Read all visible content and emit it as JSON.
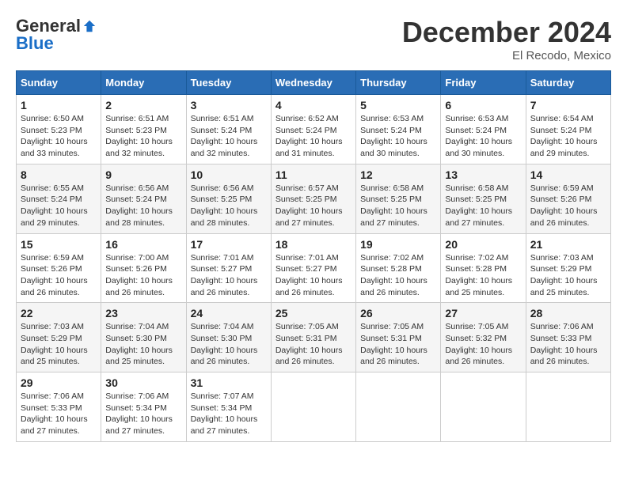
{
  "logo": {
    "general": "General",
    "blue": "Blue"
  },
  "title": "December 2024",
  "subtitle": "El Recodo, Mexico",
  "headers": [
    "Sunday",
    "Monday",
    "Tuesday",
    "Wednesday",
    "Thursday",
    "Friday",
    "Saturday"
  ],
  "weeks": [
    [
      {
        "day": "1",
        "sunrise": "Sunrise: 6:50 AM",
        "sunset": "Sunset: 5:23 PM",
        "daylight": "Daylight: 10 hours and 33 minutes."
      },
      {
        "day": "2",
        "sunrise": "Sunrise: 6:51 AM",
        "sunset": "Sunset: 5:23 PM",
        "daylight": "Daylight: 10 hours and 32 minutes."
      },
      {
        "day": "3",
        "sunrise": "Sunrise: 6:51 AM",
        "sunset": "Sunset: 5:24 PM",
        "daylight": "Daylight: 10 hours and 32 minutes."
      },
      {
        "day": "4",
        "sunrise": "Sunrise: 6:52 AM",
        "sunset": "Sunset: 5:24 PM",
        "daylight": "Daylight: 10 hours and 31 minutes."
      },
      {
        "day": "5",
        "sunrise": "Sunrise: 6:53 AM",
        "sunset": "Sunset: 5:24 PM",
        "daylight": "Daylight: 10 hours and 30 minutes."
      },
      {
        "day": "6",
        "sunrise": "Sunrise: 6:53 AM",
        "sunset": "Sunset: 5:24 PM",
        "daylight": "Daylight: 10 hours and 30 minutes."
      },
      {
        "day": "7",
        "sunrise": "Sunrise: 6:54 AM",
        "sunset": "Sunset: 5:24 PM",
        "daylight": "Daylight: 10 hours and 29 minutes."
      }
    ],
    [
      {
        "day": "8",
        "sunrise": "Sunrise: 6:55 AM",
        "sunset": "Sunset: 5:24 PM",
        "daylight": "Daylight: 10 hours and 29 minutes."
      },
      {
        "day": "9",
        "sunrise": "Sunrise: 6:56 AM",
        "sunset": "Sunset: 5:24 PM",
        "daylight": "Daylight: 10 hours and 28 minutes."
      },
      {
        "day": "10",
        "sunrise": "Sunrise: 6:56 AM",
        "sunset": "Sunset: 5:25 PM",
        "daylight": "Daylight: 10 hours and 28 minutes."
      },
      {
        "day": "11",
        "sunrise": "Sunrise: 6:57 AM",
        "sunset": "Sunset: 5:25 PM",
        "daylight": "Daylight: 10 hours and 27 minutes."
      },
      {
        "day": "12",
        "sunrise": "Sunrise: 6:58 AM",
        "sunset": "Sunset: 5:25 PM",
        "daylight": "Daylight: 10 hours and 27 minutes."
      },
      {
        "day": "13",
        "sunrise": "Sunrise: 6:58 AM",
        "sunset": "Sunset: 5:25 PM",
        "daylight": "Daylight: 10 hours and 27 minutes."
      },
      {
        "day": "14",
        "sunrise": "Sunrise: 6:59 AM",
        "sunset": "Sunset: 5:26 PM",
        "daylight": "Daylight: 10 hours and 26 minutes."
      }
    ],
    [
      {
        "day": "15",
        "sunrise": "Sunrise: 6:59 AM",
        "sunset": "Sunset: 5:26 PM",
        "daylight": "Daylight: 10 hours and 26 minutes."
      },
      {
        "day": "16",
        "sunrise": "Sunrise: 7:00 AM",
        "sunset": "Sunset: 5:26 PM",
        "daylight": "Daylight: 10 hours and 26 minutes."
      },
      {
        "day": "17",
        "sunrise": "Sunrise: 7:01 AM",
        "sunset": "Sunset: 5:27 PM",
        "daylight": "Daylight: 10 hours and 26 minutes."
      },
      {
        "day": "18",
        "sunrise": "Sunrise: 7:01 AM",
        "sunset": "Sunset: 5:27 PM",
        "daylight": "Daylight: 10 hours and 26 minutes."
      },
      {
        "day": "19",
        "sunrise": "Sunrise: 7:02 AM",
        "sunset": "Sunset: 5:28 PM",
        "daylight": "Daylight: 10 hours and 26 minutes."
      },
      {
        "day": "20",
        "sunrise": "Sunrise: 7:02 AM",
        "sunset": "Sunset: 5:28 PM",
        "daylight": "Daylight: 10 hours and 25 minutes."
      },
      {
        "day": "21",
        "sunrise": "Sunrise: 7:03 AM",
        "sunset": "Sunset: 5:29 PM",
        "daylight": "Daylight: 10 hours and 25 minutes."
      }
    ],
    [
      {
        "day": "22",
        "sunrise": "Sunrise: 7:03 AM",
        "sunset": "Sunset: 5:29 PM",
        "daylight": "Daylight: 10 hours and 25 minutes."
      },
      {
        "day": "23",
        "sunrise": "Sunrise: 7:04 AM",
        "sunset": "Sunset: 5:30 PM",
        "daylight": "Daylight: 10 hours and 25 minutes."
      },
      {
        "day": "24",
        "sunrise": "Sunrise: 7:04 AM",
        "sunset": "Sunset: 5:30 PM",
        "daylight": "Daylight: 10 hours and 26 minutes."
      },
      {
        "day": "25",
        "sunrise": "Sunrise: 7:05 AM",
        "sunset": "Sunset: 5:31 PM",
        "daylight": "Daylight: 10 hours and 26 minutes."
      },
      {
        "day": "26",
        "sunrise": "Sunrise: 7:05 AM",
        "sunset": "Sunset: 5:31 PM",
        "daylight": "Daylight: 10 hours and 26 minutes."
      },
      {
        "day": "27",
        "sunrise": "Sunrise: 7:05 AM",
        "sunset": "Sunset: 5:32 PM",
        "daylight": "Daylight: 10 hours and 26 minutes."
      },
      {
        "day": "28",
        "sunrise": "Sunrise: 7:06 AM",
        "sunset": "Sunset: 5:33 PM",
        "daylight": "Daylight: 10 hours and 26 minutes."
      }
    ],
    [
      {
        "day": "29",
        "sunrise": "Sunrise: 7:06 AM",
        "sunset": "Sunset: 5:33 PM",
        "daylight": "Daylight: 10 hours and 27 minutes."
      },
      {
        "day": "30",
        "sunrise": "Sunrise: 7:06 AM",
        "sunset": "Sunset: 5:34 PM",
        "daylight": "Daylight: 10 hours and 27 minutes."
      },
      {
        "day": "31",
        "sunrise": "Sunrise: 7:07 AM",
        "sunset": "Sunset: 5:34 PM",
        "daylight": "Daylight: 10 hours and 27 minutes."
      },
      null,
      null,
      null,
      null
    ]
  ]
}
